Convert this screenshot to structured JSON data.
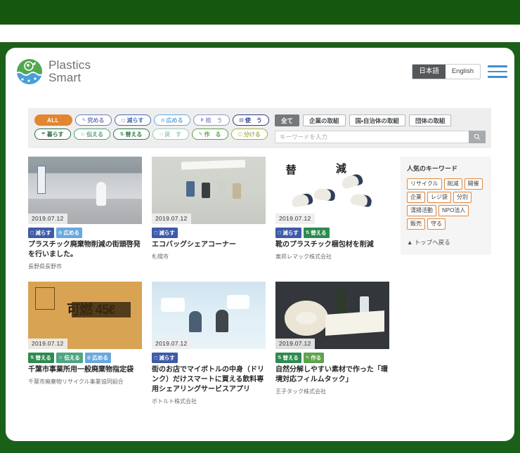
{
  "header": {
    "logo_line1": "Plastics",
    "logo_line2": "Smart",
    "lang_ja": "日本語",
    "lang_en": "English"
  },
  "filters": {
    "chips_row1": [
      {
        "label": "ALL",
        "icon": "",
        "active": true
      },
      {
        "label": "究める",
        "icon": "✎",
        "color": "#6f7bb5"
      },
      {
        "label": "減らす",
        "icon": "◻",
        "color": "#4b69b0"
      },
      {
        "label": "広める",
        "icon": "◍",
        "color": "#63a8dc"
      },
      {
        "label": "拾　う",
        "icon": "❥",
        "color": "#8e97c9"
      },
      {
        "label": "使　う",
        "icon": "▤",
        "color": "#2f3b86"
      }
    ],
    "chips_row2": [
      {
        "label": "暮らす",
        "icon": "☂",
        "color": "#2e6b44"
      },
      {
        "label": "伝える",
        "icon": "☺",
        "color": "#4f9f7a"
      },
      {
        "label": "替える",
        "icon": "⇅",
        "color": "#2d7a43"
      },
      {
        "label": "戻　す",
        "icon": "◇",
        "color": "#9fcbb5"
      },
      {
        "label": "作　る",
        "icon": "✎",
        "color": "#5f9e4a"
      },
      {
        "label": "分ける",
        "icon": "◫",
        "color": "#a8ae4f"
      }
    ],
    "tabs": [
      {
        "label": "全て",
        "active": true
      },
      {
        "label": "企業の取組",
        "active": false
      },
      {
        "label": "国・自治体の取組",
        "active": false
      },
      {
        "label": "団体の取組",
        "active": false
      }
    ],
    "search_placeholder": "キーワードを入力",
    "search_value": "",
    "search_icon": "search-icon"
  },
  "cards": [
    {
      "date": "2019.07.12",
      "art": "t1",
      "badges": [
        {
          "label": "減らす",
          "icon": "◻",
          "color": "#3f5ba8"
        },
        {
          "label": "広める",
          "icon": "◍",
          "color": "#69a8dd"
        }
      ],
      "title": "プラスチック廃棄物削減の街頭啓発を行いました。",
      "org": "長野県長野市"
    },
    {
      "date": "2019.07.12",
      "art": "t2",
      "badges": [
        {
          "label": "減らす",
          "icon": "◻",
          "color": "#3f5ba8"
        }
      ],
      "title": "エコバッグシェアコーナー",
      "org": "札幌市"
    },
    {
      "date": "2019.07.12",
      "art": "t3",
      "badges": [
        {
          "label": "減らす",
          "icon": "◻",
          "color": "#3f5ba8"
        },
        {
          "label": "替える",
          "icon": "⇅",
          "color": "#2e8b4f"
        }
      ],
      "title": "靴のプラスチック梱包材を削減",
      "org": "東邦レマック株式会社"
    },
    {
      "date": "2019.07.12",
      "art": "t4",
      "badges": [
        {
          "label": "替える",
          "icon": "⇅",
          "color": "#2e8b4f"
        },
        {
          "label": "伝える",
          "icon": "☺",
          "color": "#4fa583"
        },
        {
          "label": "広める",
          "icon": "◍",
          "color": "#69a8dd"
        }
      ],
      "title": "千葉市事業所用一般廃棄物指定袋",
      "org": "千葉市廃棄物リサイクル事業協同組合"
    },
    {
      "date": "2019.07.12",
      "art": "t5",
      "badges": [
        {
          "label": "減らす",
          "icon": "◻",
          "color": "#3f5ba8"
        }
      ],
      "title": "街のお店でマイボトルの中身（ドリンク）だけスマートに買える飲料専用シェアリングサービスアプリ",
      "org": "ボトルト株式会社"
    },
    {
      "date": "2019.07.12",
      "art": "t6",
      "badges": [
        {
          "label": "替える",
          "icon": "⇅",
          "color": "#2e8b4f"
        },
        {
          "label": "作る",
          "icon": "✎",
          "color": "#5fa24c"
        }
      ],
      "title": "自然分解しやすい素材で作った「環境対応フィルムタック」",
      "org": "王子タック株式会社"
    }
  ],
  "sidebar": {
    "title": "人気のキーワード",
    "keywords": [
      "リサイクル",
      "削減",
      "開催",
      "企業",
      "レジ袋",
      "分別",
      "清掃活動",
      "NPO法人",
      "販売",
      "守る"
    ],
    "back_to_top": "▲ トップへ戻る"
  },
  "thumb_text": {
    "t3_k1": "替",
    "t3_k2": "減",
    "t4_label": "可燃 45ℓ"
  },
  "colors": {
    "brand_green": "#1b6019",
    "top_band": "#16570f",
    "accent_orange": "#e2862f",
    "keyword_border": "#e2873a",
    "hamburger_blue": "#3f8ed0"
  }
}
